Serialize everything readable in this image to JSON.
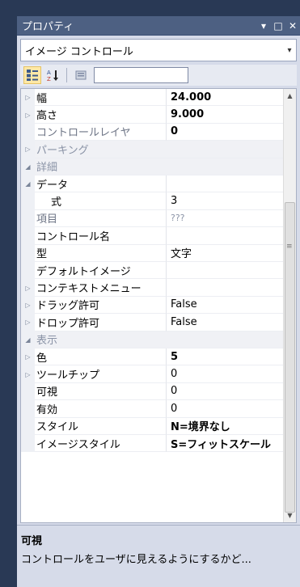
{
  "window": {
    "title": "プロパティ",
    "pin_glyph": "▾",
    "restore_glyph": "□",
    "close_glyph": "✕"
  },
  "selector": {
    "value": "イメージ コントロール",
    "arrow": "▾"
  },
  "toolbar": {
    "search_value": ""
  },
  "grid": {
    "rows": [
      {
        "type": "prop",
        "expander": "▷",
        "name": "幅",
        "value": "24.000",
        "bold": true
      },
      {
        "type": "prop",
        "expander": "▷",
        "name": "高さ",
        "value": "9.000",
        "bold": true
      },
      {
        "type": "prop",
        "expander": "",
        "name": "コントロールレイヤ",
        "name_gray": true,
        "value": "0",
        "bold": true,
        "value_gray": true
      },
      {
        "type": "cat",
        "expander": "▷",
        "name": "パーキング",
        "value": ""
      },
      {
        "type": "cat",
        "expander": "◢",
        "name": "詳細",
        "value": ""
      },
      {
        "type": "prop",
        "expander": "◢",
        "name": "データ",
        "value": ""
      },
      {
        "type": "prop",
        "expander": "",
        "name": "式",
        "indent": true,
        "value": "3"
      },
      {
        "type": "prop",
        "expander": "",
        "name": "項目",
        "name_gray": true,
        "value": "???",
        "value_small_gray": true
      },
      {
        "type": "prop",
        "expander": "",
        "name": "コントロール名",
        "value": ""
      },
      {
        "type": "prop",
        "expander": "",
        "name": "型",
        "value": "文字"
      },
      {
        "type": "prop",
        "expander": "",
        "name": "デフォルトイメージ",
        "value": ""
      },
      {
        "type": "prop",
        "expander": "▷",
        "name": "コンテキストメニュー",
        "value": ""
      },
      {
        "type": "prop",
        "expander": "▷",
        "name": "ドラッグ許可",
        "value": "False"
      },
      {
        "type": "prop",
        "expander": "▷",
        "name": "ドロップ許可",
        "value": "False"
      },
      {
        "type": "cat",
        "expander": "◢",
        "name": "表示",
        "value": ""
      },
      {
        "type": "prop",
        "expander": "▷",
        "name": "色",
        "value": "5",
        "bold": true
      },
      {
        "type": "prop",
        "expander": "▷",
        "name": "ツールチップ",
        "value": "0"
      },
      {
        "type": "prop",
        "expander": "",
        "name": "可視",
        "value": "0"
      },
      {
        "type": "prop",
        "expander": "",
        "name": "有効",
        "value": "0"
      },
      {
        "type": "prop",
        "expander": "",
        "name": "スタイル",
        "value": "N=境界なし",
        "bold": true
      },
      {
        "type": "prop",
        "expander": "",
        "name": "イメージスタイル",
        "value": "S=フィットスケール",
        "bold": true
      }
    ],
    "scroll_up": "▲",
    "scroll_down": "▼",
    "scroll_grip": "≡"
  },
  "description": {
    "title": "可視",
    "text": "コントロールをユーザに見えるようにするかど..."
  },
  "colors": {
    "title_bar": "#4d6082",
    "panel_bg": "#d6dbe9",
    "workspace_bg": "#293955"
  }
}
